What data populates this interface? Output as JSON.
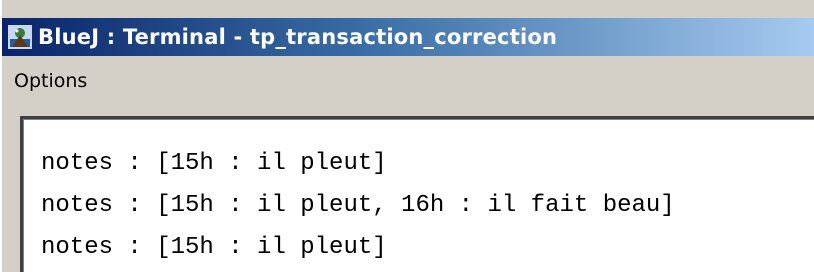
{
  "window": {
    "title": "BlueJ : Terminal - tp_transaction_correction",
    "icon": "bluej-app-icon"
  },
  "menubar": {
    "items": [
      {
        "label": "Options"
      }
    ]
  },
  "terminal": {
    "lines": [
      "notes : [15h : il pleut]",
      "notes : [15h : il pleut, 16h : il fait beau]",
      "notes : [15h : il pleut]"
    ]
  },
  "colors": {
    "titlebar_start": "#0a246a",
    "titlebar_end": "#a6caf0",
    "window_bg": "#d4d0c8",
    "terminal_bg": "#ffffff"
  }
}
